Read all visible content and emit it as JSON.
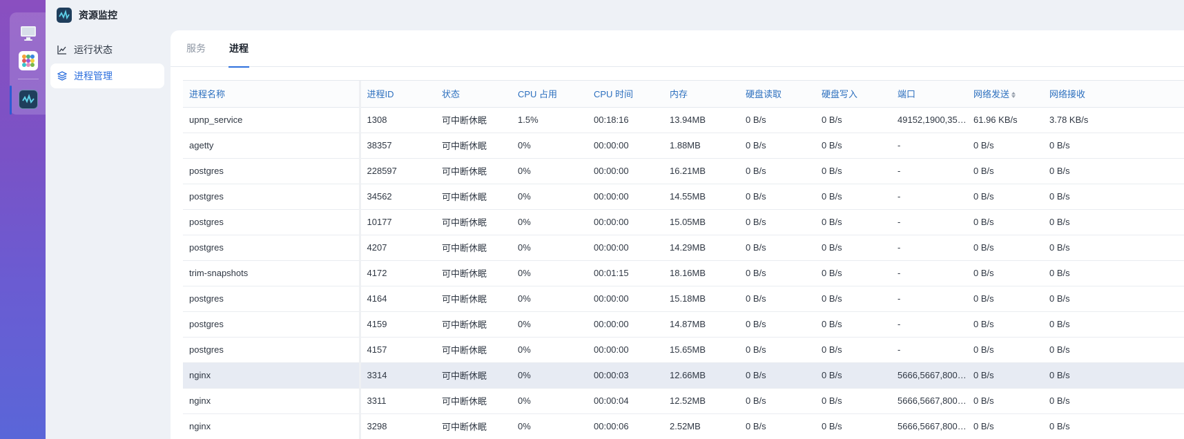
{
  "app": {
    "title": "资源监控",
    "logo_icon": "activity-monitor-icon"
  },
  "dock": {
    "items": [
      {
        "name": "desktop-icon"
      },
      {
        "name": "apps-grid-icon"
      },
      {
        "name": "resource-monitor-icon",
        "active": true
      }
    ]
  },
  "nav": {
    "items": [
      {
        "label": "运行状态",
        "icon": "line-chart-icon",
        "active": false
      },
      {
        "label": "进程管理",
        "icon": "layers-icon",
        "active": true
      }
    ]
  },
  "tabs": [
    {
      "label": "服务",
      "active": false
    },
    {
      "label": "进程",
      "active": true
    }
  ],
  "table": {
    "columns": [
      "进程名称",
      "进程ID",
      "状态",
      "CPU 占用",
      "CPU 时间",
      "内存",
      "硬盘读取",
      "硬盘写入",
      "端口",
      "网络发送",
      "网络接收"
    ],
    "sorted_column": "网络发送",
    "rows": [
      [
        "upnp_service",
        "1308",
        "可中断休眠",
        "1.5%",
        "00:18:16",
        "13.94MB",
        "0 B/s",
        "0 B/s",
        "49152,1900,35…",
        "61.96 KB/s",
        "3.78 KB/s"
      ],
      [
        "agetty",
        "38357",
        "可中断休眠",
        "0%",
        "00:00:00",
        "1.88MB",
        "0 B/s",
        "0 B/s",
        "-",
        "0 B/s",
        "0 B/s"
      ],
      [
        "postgres",
        "228597",
        "可中断休眠",
        "0%",
        "00:00:00",
        "16.21MB",
        "0 B/s",
        "0 B/s",
        "-",
        "0 B/s",
        "0 B/s"
      ],
      [
        "postgres",
        "34562",
        "可中断休眠",
        "0%",
        "00:00:00",
        "14.55MB",
        "0 B/s",
        "0 B/s",
        "-",
        "0 B/s",
        "0 B/s"
      ],
      [
        "postgres",
        "10177",
        "可中断休眠",
        "0%",
        "00:00:00",
        "15.05MB",
        "0 B/s",
        "0 B/s",
        "-",
        "0 B/s",
        "0 B/s"
      ],
      [
        "postgres",
        "4207",
        "可中断休眠",
        "0%",
        "00:00:00",
        "14.29MB",
        "0 B/s",
        "0 B/s",
        "-",
        "0 B/s",
        "0 B/s"
      ],
      [
        "trim-snapshots",
        "4172",
        "可中断休眠",
        "0%",
        "00:01:15",
        "18.16MB",
        "0 B/s",
        "0 B/s",
        "-",
        "0 B/s",
        "0 B/s"
      ],
      [
        "postgres",
        "4164",
        "可中断休眠",
        "0%",
        "00:00:00",
        "15.18MB",
        "0 B/s",
        "0 B/s",
        "-",
        "0 B/s",
        "0 B/s"
      ],
      [
        "postgres",
        "4159",
        "可中断休眠",
        "0%",
        "00:00:00",
        "14.87MB",
        "0 B/s",
        "0 B/s",
        "-",
        "0 B/s",
        "0 B/s"
      ],
      [
        "postgres",
        "4157",
        "可中断休眠",
        "0%",
        "00:00:00",
        "15.65MB",
        "0 B/s",
        "0 B/s",
        "-",
        "0 B/s",
        "0 B/s"
      ],
      [
        "nginx",
        "3314",
        "可中断休眠",
        "0%",
        "00:00:03",
        "12.66MB",
        "0 B/s",
        "0 B/s",
        "5666,5667,800…",
        "0 B/s",
        "0 B/s"
      ],
      [
        "nginx",
        "3311",
        "可中断休眠",
        "0%",
        "00:00:04",
        "12.52MB",
        "0 B/s",
        "0 B/s",
        "5666,5667,800…",
        "0 B/s",
        "0 B/s"
      ],
      [
        "nginx",
        "3298",
        "可中断休眠",
        "0%",
        "00:00:06",
        "2.52MB",
        "0 B/s",
        "0 B/s",
        "5666,5667,800…",
        "0 B/s",
        "0 B/s"
      ]
    ],
    "highlighted_row": 10
  },
  "colors": {
    "accent": "#2d6fdd",
    "header_text": "#2c6fbe",
    "row_highlight": "#e7ebf3"
  }
}
